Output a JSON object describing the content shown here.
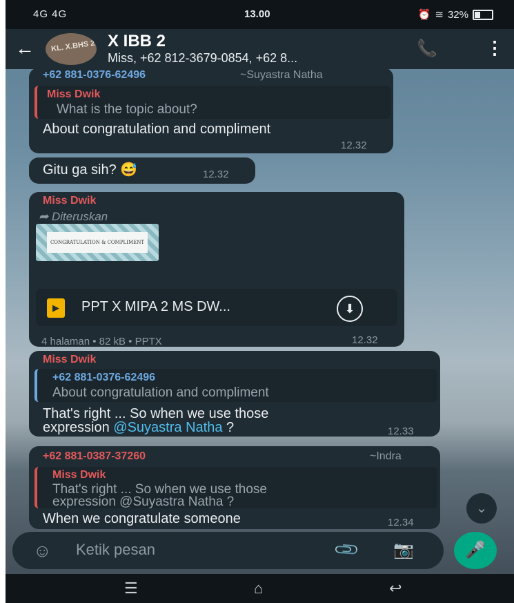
{
  "status": {
    "signal": "4G 4G",
    "time": "13.00",
    "battery": "32%"
  },
  "header": {
    "back_icon": "arrow-left",
    "avatar_text": "KL. X.BHS 2",
    "title": "X IBB 2",
    "subtitle": "Miss, +62 812-3679-0854, +62 8...",
    "call_icon": "add-call",
    "menu_icon": "more-vert"
  },
  "messages": [
    {
      "sender": "+62 881-0376-62496",
      "alias": "~Suyastra Natha",
      "quote_sender": "Miss Dwik",
      "quote_text": "What is the topic about?",
      "text": "About congratulation and compliment",
      "time": "12.32"
    },
    {
      "text": "Gitu ga sih? 😅",
      "time": "12.32"
    },
    {
      "sender": "Miss Dwik",
      "forwarded": "Diteruskan",
      "thumb_text": "CONGRATULATION & COMPLIMENT",
      "doc_name": "PPT X MIPA 2 MS DW...",
      "doc_meta": "4 halaman • 82 kB • PPTX",
      "time": "12.32"
    },
    {
      "sender": "Miss Dwik",
      "quote_sender": "+62 881-0376-62496",
      "quote_text": "About congratulation and compliment",
      "text_line1": "That's right ... So when we use those",
      "text_line2a": "expression ",
      "mention": "@Suyastra Natha",
      "text_line2b": " ?",
      "time": "12.33"
    },
    {
      "sender": "+62 881-0387-37260",
      "alias": "~Indra",
      "quote_sender": "Miss Dwik",
      "quote_line1": "That's right ... So when we use those",
      "quote_line2": "expression @Suyastra Natha ?",
      "text": "When we  congratulate someone",
      "time": "12.34"
    }
  ],
  "input": {
    "placeholder": "Ketik pesan"
  },
  "colors": {
    "accent": "#00a884",
    "bubble": "#1f2c34",
    "quote_name": "#e4595a",
    "mention": "#53bdeb"
  }
}
